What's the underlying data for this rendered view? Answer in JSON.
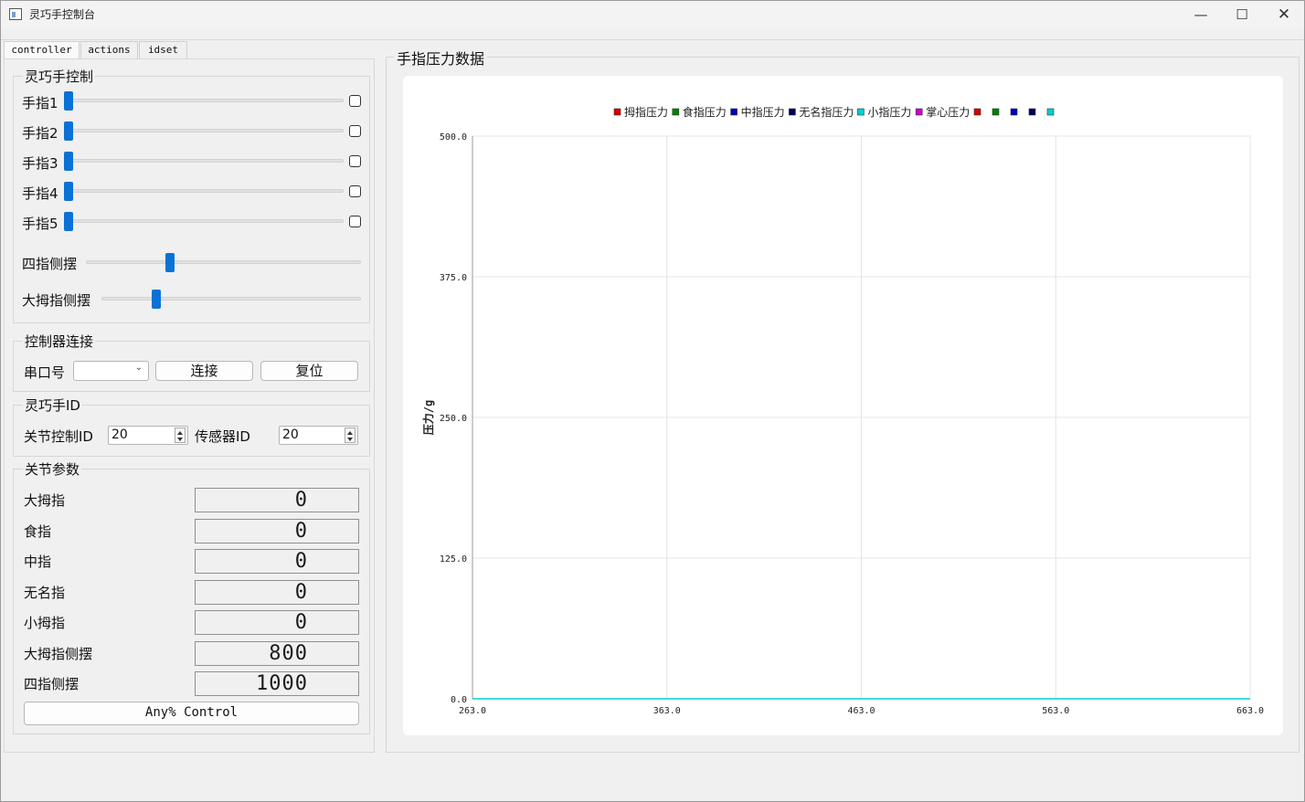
{
  "window": {
    "title": "灵巧手控制台",
    "minimize": "—",
    "maximize": "☐",
    "close": "✕"
  },
  "tabs": [
    "controller",
    "actions",
    "idset"
  ],
  "hand_control": {
    "title": "灵巧手控制",
    "fingers": [
      {
        "label": "手指1",
        "value": 0,
        "checked": false
      },
      {
        "label": "手指2",
        "value": 0,
        "checked": false
      },
      {
        "label": "手指3",
        "value": 0,
        "checked": false
      },
      {
        "label": "手指4",
        "value": 0,
        "checked": false
      },
      {
        "label": "手指5",
        "value": 0,
        "checked": false
      }
    ],
    "four_finger_swing": {
      "label": "四指侧摆",
      "value": 0.3
    },
    "thumb_swing": {
      "label": "大拇指侧摆",
      "value": 0.2
    }
  },
  "connection": {
    "title": "控制器连接",
    "port_label": "串口号",
    "port_value": "",
    "connect": "连接",
    "reset": "复位"
  },
  "hand_id": {
    "title": "灵巧手ID",
    "joint_label": "关节控制ID",
    "joint_value": "20",
    "sensor_label": "传感器ID",
    "sensor_value": "20"
  },
  "joint_params": {
    "title": "关节参数",
    "rows": [
      {
        "label": "大拇指",
        "value": "0"
      },
      {
        "label": "食指",
        "value": "0"
      },
      {
        "label": "中指",
        "value": "0"
      },
      {
        "label": "无名指",
        "value": "0"
      },
      {
        "label": "小拇指",
        "value": "0"
      },
      {
        "label": "大拇指侧摆",
        "value": "800"
      },
      {
        "label": "四指侧摆",
        "value": "1000"
      }
    ],
    "any_control": "Any% Control"
  },
  "chart_panel": {
    "title": "手指压力数据"
  },
  "chart_data": {
    "type": "line",
    "title": "",
    "xlabel": "",
    "ylabel": "压力/g",
    "xlim": [
      263.0,
      663.0
    ],
    "ylim": [
      0.0,
      500.0
    ],
    "xticks": [
      "263.0",
      "363.0",
      "463.0",
      "563.0",
      "663.0"
    ],
    "yticks": [
      "0.0",
      "125.0",
      "250.0",
      "375.0",
      "500.0"
    ],
    "grid": true,
    "legend_position": "top",
    "legend": [
      {
        "name": "拇指压力",
        "color": "#d40000"
      },
      {
        "name": "食指压力",
        "color": "#008000"
      },
      {
        "name": "中指压力",
        "color": "#0000c8"
      },
      {
        "name": "无名指压力",
        "color": "#000060"
      },
      {
        "name": "小指压力",
        "color": "#00d0d0"
      },
      {
        "name": "掌心压力",
        "color": "#d000d0"
      },
      {
        "name": "",
        "color": "#d40000"
      },
      {
        "name": "",
        "color": "#008000"
      },
      {
        "name": "",
        "color": "#0000c8"
      },
      {
        "name": "",
        "color": "#000060"
      },
      {
        "name": "",
        "color": "#00d0d0"
      }
    ],
    "series": [
      {
        "color": "#00d0d0",
        "x": [
          263.0,
          663.0
        ],
        "y": [
          0.0,
          0.0
        ]
      }
    ]
  }
}
